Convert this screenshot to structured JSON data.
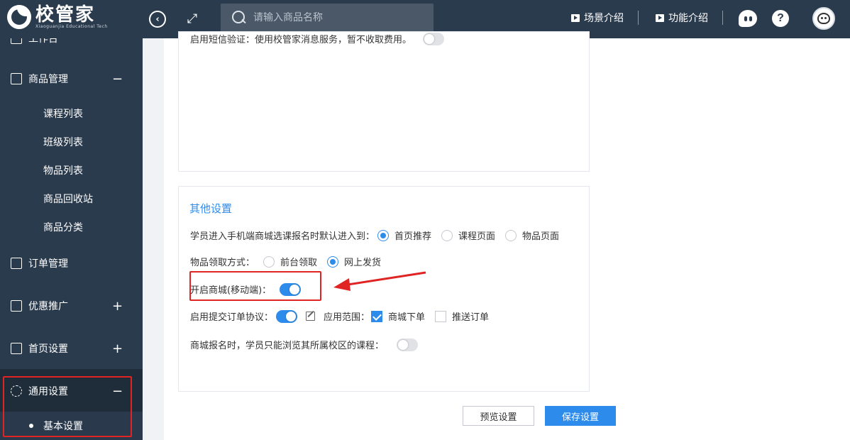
{
  "header": {
    "logo_title": "校管家",
    "logo_subtitle": "Xiaoguanjia Educational Tech",
    "search_placeholder": "请输入商品名称",
    "scene_intro": "场景介绍",
    "feature_intro": "功能介绍",
    "help_label": "?"
  },
  "sidebar": {
    "top_partial": "工作台",
    "product_mgmt": "商品管理",
    "product_children": [
      "课程列表",
      "班级列表",
      "物品列表",
      "商品回收站",
      "商品分类"
    ],
    "order_mgmt": "订单管理",
    "promotion": "优惠推广",
    "home_settings": "首页设置",
    "general_settings": "通用设置",
    "basic_settings": "基本设置",
    "collapse_symbol": "−",
    "expand_symbol": "+"
  },
  "main": {
    "sms_label": "启用短信验证：使用校管家消息服务，暂不收取费用。",
    "other_title": "其他设置",
    "default_entry_label": "学员进入手机端商城选课报名时默认进入到：",
    "default_entry_options": [
      "首页推荐",
      "课程页面",
      "物品页面"
    ],
    "default_entry_selected": "首页推荐",
    "pickup_label": "物品领取方式：",
    "pickup_options": [
      "前台领取",
      "网上发货"
    ],
    "pickup_selected": "网上发货",
    "mall_mobile_label": "开启商城(移动端)：",
    "mall_mobile_on": true,
    "order_agreement_label": "启用提交订单协议：",
    "order_agreement_on": true,
    "scope_label": "应用范围：",
    "scope_options": [
      "商城下单",
      "推送订单"
    ],
    "scope_checked": [
      "商城下单"
    ],
    "campus_only_label": "商城报名时，学员只能浏览其所属校区的课程：",
    "campus_only_on": false,
    "preview_button": "预览设置",
    "save_button": "保存设置"
  },
  "colors": {
    "header_bg": "#2b3b4e",
    "accent": "#2d8ceb",
    "highlight_red": "#e02424"
  }
}
